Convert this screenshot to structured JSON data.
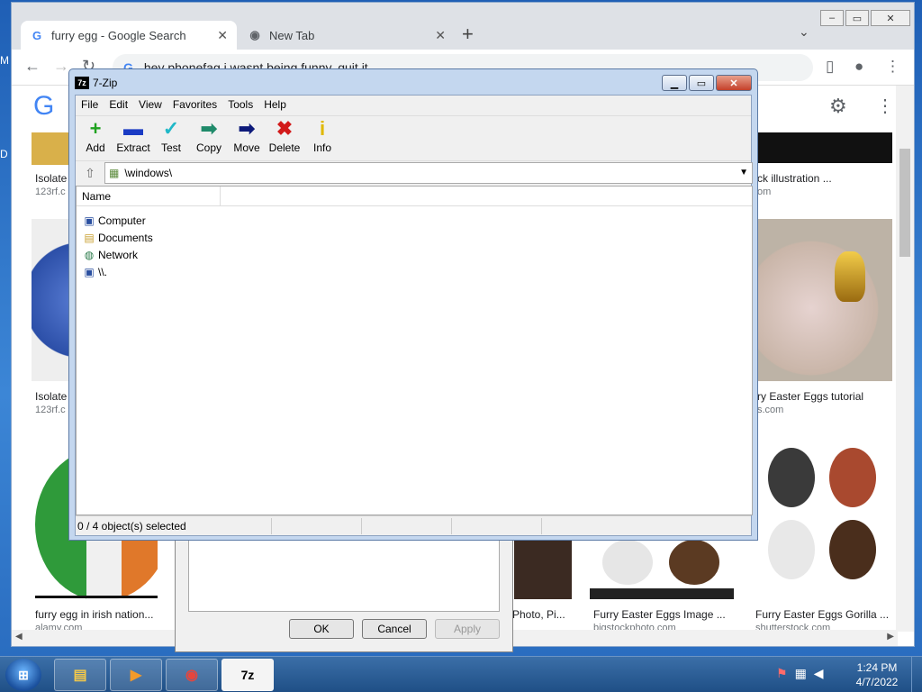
{
  "desktop": {
    "labels": [
      "M",
      "D"
    ]
  },
  "chrome": {
    "tabs": [
      {
        "label": "furry egg - Google Search",
        "favicon": "G",
        "close": "✕"
      },
      {
        "label": "New Tab",
        "favicon": "◉",
        "close": "✕"
      }
    ],
    "new_tab": "+",
    "tab_menu": "⌄",
    "window_buttons": {
      "minimize": "–",
      "maximize": "▭",
      "close": "✕"
    },
    "omnibox": {
      "prefix": "G",
      "text": "hey phonefag i wasnt being funny, quit it"
    },
    "nav": {
      "back": "←",
      "forward": "→",
      "reload": "↻"
    },
    "toolbar_icons": {
      "sidebar": "▯",
      "profile": "●",
      "menu": "⋮"
    }
  },
  "google": {
    "logo": "G",
    "gear": "⚙",
    "apps": "⋮⋮⋮",
    "results": [
      {
        "caption": "Isolate",
        "source": "123rf.c"
      },
      {
        "caption": "ck illustration ...",
        "source": "om"
      },
      {
        "caption": "Isolate",
        "source": "123rf.c"
      },
      {
        "caption": "ry Easter Eggs tutorial",
        "source": "s.com"
      },
      {
        "caption": "furry egg in irish nation...",
        "source": "alamy.com"
      },
      {
        "caption": "Photo, Pi...",
        "source": ""
      },
      {
        "caption": "Furry Easter Eggs Image ...",
        "source": "bigstockphoto.com"
      },
      {
        "caption": "Furry Easter Eggs Gorilla ...",
        "source": "shutterstock.com"
      }
    ]
  },
  "properties_dialog": {
    "ok": "OK",
    "cancel": "Cancel",
    "apply": "Apply"
  },
  "sevenzip": {
    "title": "7-Zip",
    "logo": "7z",
    "menu": [
      "File",
      "Edit",
      "View",
      "Favorites",
      "Tools",
      "Help"
    ],
    "toolbar": [
      {
        "label": "Add",
        "icon": "+",
        "color": "#1fa21f"
      },
      {
        "label": "Extract",
        "icon": "▬",
        "color": "#1a3bc4"
      },
      {
        "label": "Test",
        "icon": "✓",
        "color": "#20b8c8"
      },
      {
        "label": "Copy",
        "icon": "➡",
        "color": "#1f8a6a"
      },
      {
        "label": "Move",
        "icon": "➡",
        "color": "#0d1a7a"
      },
      {
        "label": "Delete",
        "icon": "✖",
        "color": "#d21a1a"
      },
      {
        "label": "Info",
        "icon": "i",
        "color": "#e0b800"
      }
    ],
    "address": "\\windows\\",
    "column_name": "Name",
    "items": [
      {
        "name": "Computer",
        "icon": "▣"
      },
      {
        "name": "Documents",
        "icon": "▤"
      },
      {
        "name": "Network",
        "icon": "◍"
      },
      {
        "name": "\\\\.",
        "icon": "▣"
      }
    ],
    "status": "0 / 4 object(s) selected"
  },
  "taskbar": {
    "start": "⊞",
    "items": [
      {
        "name": "explorer",
        "icon": "▤"
      },
      {
        "name": "media-player",
        "icon": "▶"
      },
      {
        "name": "chrome",
        "icon": "◉"
      },
      {
        "name": "7zip",
        "icon": "7z"
      }
    ],
    "tray": [
      "⚑",
      "▦",
      "◀"
    ],
    "time": "1:24 PM",
    "date": "4/7/2022"
  }
}
